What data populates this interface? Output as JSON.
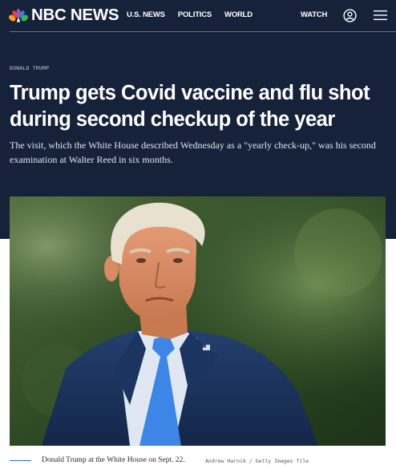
{
  "header": {
    "brand": "NBC NEWS",
    "nav": [
      "U.S. NEWS",
      "POLITICS",
      "WORLD"
    ],
    "watch_label": "WATCH",
    "icons": [
      "nbc-peacock-logo",
      "account-icon",
      "hamburger-menu-icon"
    ]
  },
  "article": {
    "eyebrow": "DONALD TRUMP",
    "headline": "Trump gets Covid vaccine and flu shot during second checkup of the year",
    "dek": "The visit, which the White House described Wednesday as a \"yearly check-up,\" was his second examination at Walter Reed in six months.",
    "image": {
      "caption": "Donald Trump at the White House on Sept. 22.",
      "credit": "Andrew Harnik / Getty Images file"
    }
  },
  "colors": {
    "hero_background": "#16213a",
    "caption_rule": "#3061ff",
    "text_on_dark": "#ffffff"
  }
}
